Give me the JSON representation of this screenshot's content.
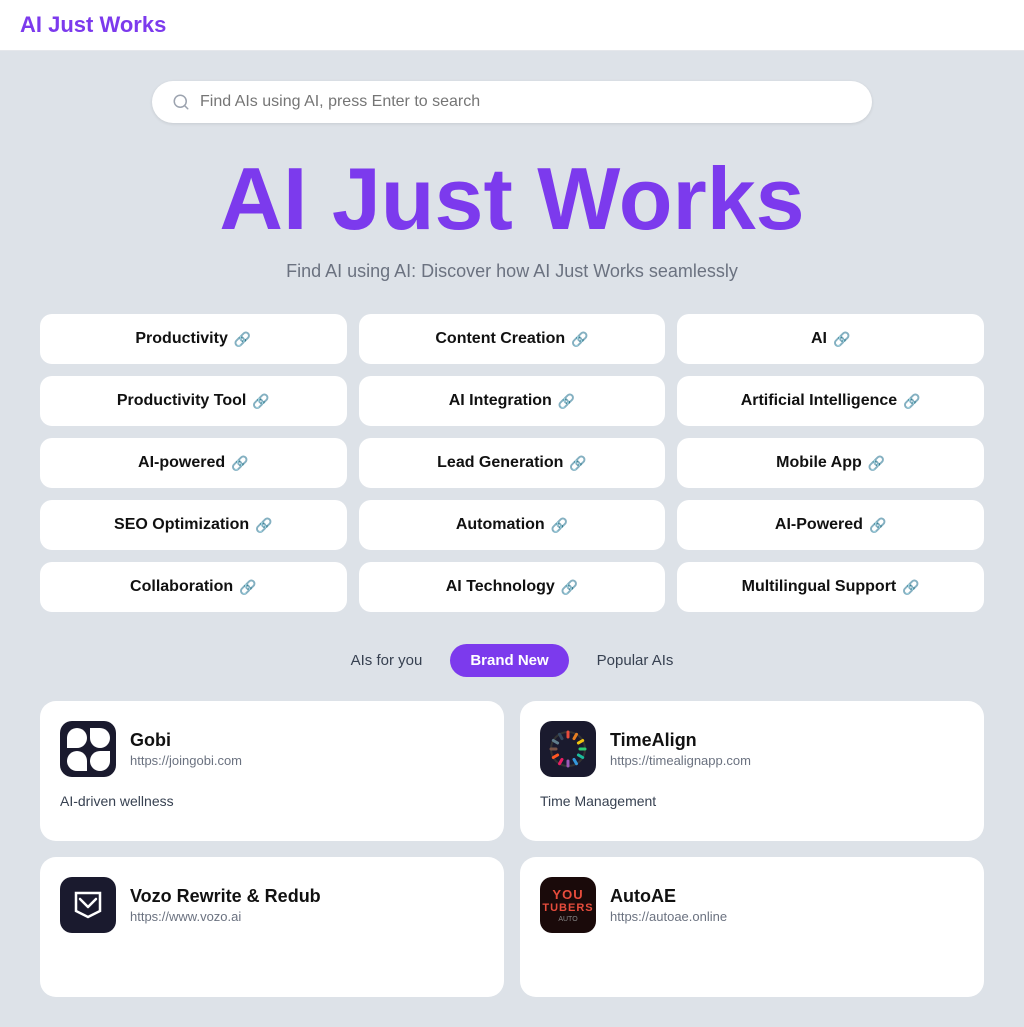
{
  "header": {
    "logo_text": "AI Just Works"
  },
  "search": {
    "placeholder": "Find AIs using AI, press Enter to search"
  },
  "hero": {
    "title": "AI Just Works",
    "subtitle": "Find AI using AI: Discover how AI Just Works seamlessly"
  },
  "tags": [
    {
      "id": "productivity",
      "label": "Productivity"
    },
    {
      "id": "content-creation",
      "label": "Content Creation"
    },
    {
      "id": "ai",
      "label": "AI"
    },
    {
      "id": "productivity-tool",
      "label": "Productivity Tool"
    },
    {
      "id": "ai-integration",
      "label": "AI Integration"
    },
    {
      "id": "artificial-intelligence",
      "label": "Artificial Intelligence"
    },
    {
      "id": "ai-powered",
      "label": "AI-powered"
    },
    {
      "id": "lead-generation",
      "label": "Lead Generation"
    },
    {
      "id": "mobile-app",
      "label": "Mobile App"
    },
    {
      "id": "seo-optimization",
      "label": "SEO Optimization"
    },
    {
      "id": "automation",
      "label": "Automation"
    },
    {
      "id": "ai-powered-2",
      "label": "AI-Powered"
    },
    {
      "id": "collaboration",
      "label": "Collaboration"
    },
    {
      "id": "ai-technology",
      "label": "AI Technology"
    },
    {
      "id": "multilingual-support",
      "label": "Multilingual Support"
    }
  ],
  "filter_tabs": [
    {
      "id": "ais-for-you",
      "label": "AIs for you",
      "active": false
    },
    {
      "id": "brand-new",
      "label": "Brand New",
      "active": true
    },
    {
      "id": "popular-ais",
      "label": "Popular AIs",
      "active": false
    }
  ],
  "ai_cards": [
    {
      "id": "gobi",
      "name": "Gobi",
      "url": "https://joingobi.com",
      "description": "AI-driven wellness",
      "logo_type": "gobi"
    },
    {
      "id": "timealign",
      "name": "TimeAlign",
      "url": "https://timealignapp.com",
      "description": "Time Management",
      "logo_type": "timealign"
    },
    {
      "id": "vozo",
      "name": "Vozo Rewrite & Redub",
      "url": "https://www.vozo.ai",
      "description": "",
      "logo_type": "vozo"
    },
    {
      "id": "autoae",
      "name": "AutoAE",
      "url": "https://autoae.online",
      "description": "",
      "logo_type": "autoae"
    }
  ]
}
